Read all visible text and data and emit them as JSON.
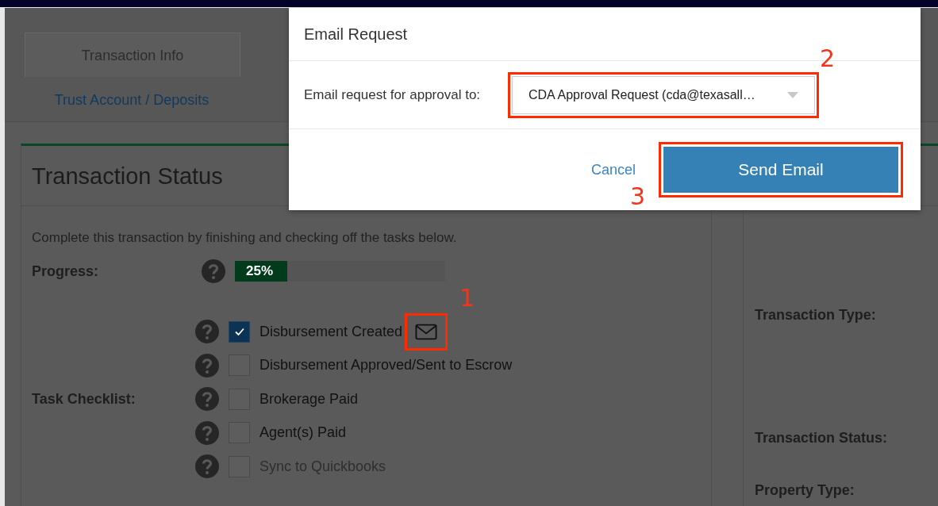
{
  "tabs": [
    {
      "label": "Transaction Info",
      "selected": true
    },
    {
      "label": "Trust Account / Deposits",
      "selected": false
    }
  ],
  "transaction_status": {
    "title": "Transaction Status",
    "description": "Complete this transaction by finishing and checking off the tasks below.",
    "progress": {
      "label": "Progress:",
      "level": 0.25,
      "reading": "25%"
    },
    "checklist": {
      "label": "Task Checklist:",
      "items": [
        {
          "label": "Disbursement Created",
          "checked": true,
          "disabled": false,
          "email_icon": true,
          "callout": "1"
        },
        {
          "label": "Disbursement Approved/Sent to Escrow",
          "checked": false,
          "disabled": false,
          "email_icon": false
        },
        {
          "label": "Brokerage Paid",
          "checked": false,
          "disabled": false,
          "email_icon": false
        },
        {
          "label": "Agent(s) Paid",
          "checked": false,
          "disabled": false,
          "email_icon": false
        },
        {
          "label": "Sync to Quickbooks",
          "checked": false,
          "disabled": true,
          "email_icon": false
        }
      ]
    }
  },
  "details": {
    "labels": [
      "Transaction Type:",
      "Transaction Status:",
      "Property Type:"
    ]
  },
  "dialog": {
    "title": "Email Request",
    "recipient": {
      "label": "Email request for approval to:",
      "value": "CDA Approval Request (cda@texasall…",
      "callout": "2"
    },
    "buttons": [
      {
        "label": "Cancel",
        "kind": "link"
      },
      {
        "label": "Send Email",
        "kind": "primary",
        "callout": "3"
      }
    ]
  }
}
